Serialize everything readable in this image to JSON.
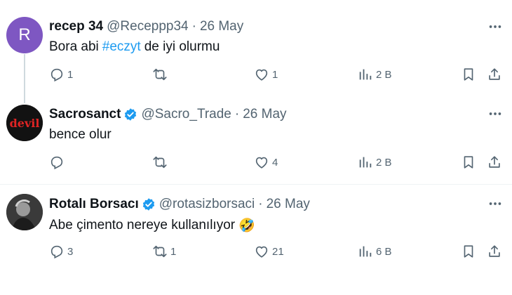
{
  "tweets": [
    {
      "avatar_letter": "R",
      "name": "recep 34",
      "handle": "@Receppp34",
      "date": "26 May",
      "text_before": "Bora abi",
      "hashtag": "#eczyt",
      "text_after": "de iyi olurmu",
      "replies": "1",
      "retweets": "",
      "likes": "1",
      "views": "2 B"
    },
    {
      "avatar_text": "devil",
      "name": "Sacrosanct",
      "handle": "@Sacro_Trade",
      "date": "26 May",
      "text": "bence olur",
      "replies": "",
      "retweets": "",
      "likes": "4",
      "views": "2 B"
    },
    {
      "name": "Rotalı Borsacı",
      "handle": "@rotasizborsaci",
      "date": "26 May",
      "text": "Abe çimento nereye kullanılıyor",
      "emoji": "🤣",
      "replies": "3",
      "retweets": "1",
      "likes": "21",
      "views": "6 B"
    }
  ],
  "separator": "·",
  "colors": {
    "accent": "#1d9bf0",
    "muted": "#536471",
    "verified": "#1d9bf0"
  },
  "icons": [
    "reply-icon",
    "retweet-icon",
    "like-icon",
    "views-icon",
    "bookmark-icon",
    "share-icon",
    "more-icon",
    "verified-icon"
  ]
}
